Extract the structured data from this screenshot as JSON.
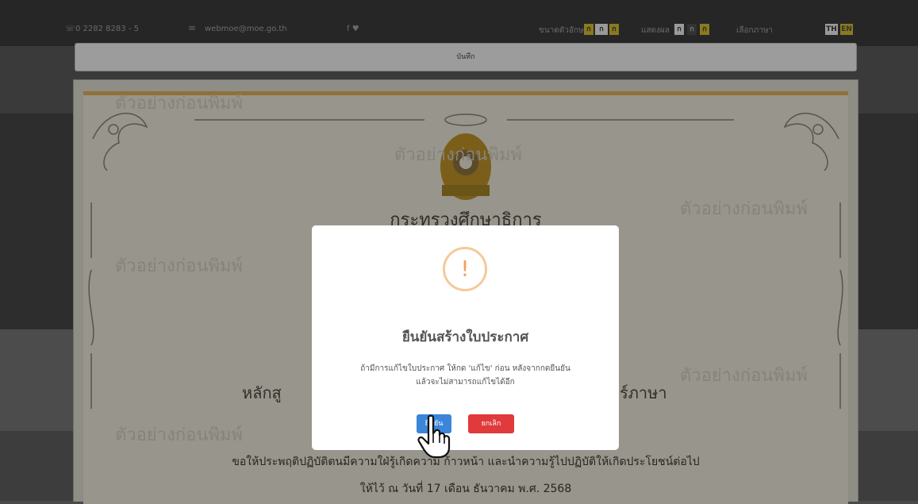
{
  "topbar": {
    "phone": "0 2282 8283 - 5",
    "email": "webmoe@moe.go.th",
    "social": "f  ♥",
    "font_size_label": "ขนาดตัวอักษร",
    "font_sizes": [
      "ก",
      "ก",
      "ก"
    ],
    "display_label": "แสดงผล",
    "display_options": [
      "ก",
      "ก",
      "ก"
    ],
    "language_label": "เลือกภาษา",
    "languages": [
      "TH",
      "EN"
    ]
  },
  "save_bar": {
    "label": "บันทึก"
  },
  "certificate": {
    "watermark": "ตัวอย่างก่อนพิมพ์",
    "organization": "กระทรวงศึกษาธิการ",
    "course_left": "หลักสู",
    "course_right": "ร์ภาษา",
    "blessing": "ขอให้ประพฤติปฏิบัติตนมีความใฝ่รู้เกิดความ ก้าวหน้า และนำความรู้ไปปฏิบัติให้เกิดประโยชน์ต่อไป",
    "date_line": "ให้ไว้ ณ วันที่ 17 เดือน ธันวาคม พ.ศ. 2568"
  },
  "modal": {
    "icon": "exclamation-icon",
    "icon_glyph": "!",
    "title": "ยืนยันสร้างใบประกาศ",
    "message_line1": "ถ้ามีการแก้ไขใบประกาศ ให้กด 'แก้ไข' ก่อน หลังจากกดยืนยัน",
    "message_line2": "แล้วจะไม่สามารถแก้ไขได้อีก",
    "confirm_label": "ยืนยัน",
    "cancel_label": "ยกเลิก"
  },
  "colors": {
    "confirm": "#3b86d9",
    "cancel": "#e13a3c",
    "warning": "#f3a15f",
    "gold": "#8e7138"
  }
}
